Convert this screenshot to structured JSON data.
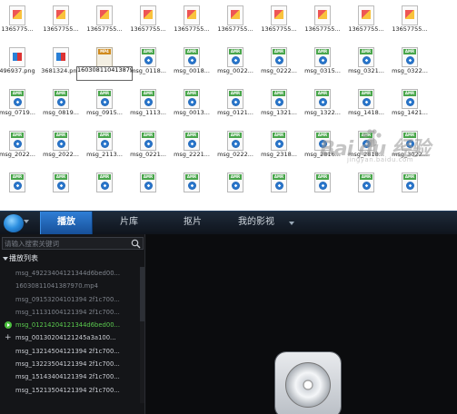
{
  "explorer": {
    "rows": [
      {
        "items": [
          {
            "label": "1365775...",
            "type": "doc"
          },
          {
            "label": "13657755...",
            "type": "doc"
          },
          {
            "label": "13657755...",
            "type": "doc"
          },
          {
            "label": "13657755...",
            "type": "doc"
          },
          {
            "label": "13657755...",
            "type": "doc"
          },
          {
            "label": "13657755...",
            "type": "doc"
          },
          {
            "label": "13657755...",
            "type": "doc"
          },
          {
            "label": "13657755...",
            "type": "doc"
          },
          {
            "label": "13657755...",
            "type": "doc"
          },
          {
            "label": "13657755...",
            "type": "doc"
          }
        ]
      },
      {
        "items": [
          {
            "label": "496937.png",
            "type": "png"
          },
          {
            "label": "3681324.png",
            "type": "png"
          },
          {
            "label": "16030811041387970.mp4",
            "type": "mp4",
            "selected": true,
            "tag": "MP4"
          },
          {
            "label": "msg_0118...",
            "type": "amr",
            "tag": "AMR"
          },
          {
            "label": "msg_0018...",
            "type": "amr",
            "tag": "AMR"
          },
          {
            "label": "msg_0022...",
            "type": "amr",
            "tag": "AMR"
          },
          {
            "label": "msg_0222...",
            "type": "amr",
            "tag": "AMR"
          },
          {
            "label": "msg_0315...",
            "type": "amr",
            "tag": "AMR"
          },
          {
            "label": "msg_0321...",
            "type": "amr",
            "tag": "AMR"
          },
          {
            "label": "msg_0322...",
            "type": "amr",
            "tag": "AMR"
          }
        ]
      },
      {
        "items": [
          {
            "label": "msg_0719...",
            "type": "amr",
            "tag": "AMR"
          },
          {
            "label": "msg_0819...",
            "type": "amr",
            "tag": "AMR"
          },
          {
            "label": "msg_0915...",
            "type": "amr",
            "tag": "AMR"
          },
          {
            "label": "msg_1113...",
            "type": "amr",
            "tag": "AMR"
          },
          {
            "label": "msg_0013...",
            "type": "amr",
            "tag": "AMR"
          },
          {
            "label": "msg_0121...",
            "type": "amr",
            "tag": "AMR"
          },
          {
            "label": "msg_1321...",
            "type": "amr",
            "tag": "AMR"
          },
          {
            "label": "msg_1322...",
            "type": "amr",
            "tag": "AMR"
          },
          {
            "label": "msg_1418...",
            "type": "amr",
            "tag": "AMR"
          },
          {
            "label": "msg_1421...",
            "type": "amr",
            "tag": "AMR"
          }
        ]
      },
      {
        "items": [
          {
            "label": "msg_2022...",
            "type": "amr",
            "tag": "AMR"
          },
          {
            "label": "msg_2022...",
            "type": "amr",
            "tag": "AMR"
          },
          {
            "label": "msg_2113...",
            "type": "amr",
            "tag": "AMR"
          },
          {
            "label": "msg_0221...",
            "type": "amr",
            "tag": "AMR"
          },
          {
            "label": "msg_2221...",
            "type": "amr",
            "tag": "AMR"
          },
          {
            "label": "msg_0222...",
            "type": "amr",
            "tag": "AMR"
          },
          {
            "label": "msg_2318...",
            "type": "amr",
            "tag": "AMR"
          },
          {
            "label": "msg_2816...",
            "type": "amr",
            "tag": "AMR"
          },
          {
            "label": "msg_2818...",
            "type": "amr",
            "tag": "AMR"
          },
          {
            "label": "msg_3022...",
            "type": "amr",
            "tag": "AMR"
          }
        ]
      },
      {
        "items": [
          {
            "label": "",
            "type": "amr",
            "tag": "AMR"
          },
          {
            "label": "",
            "type": "amr",
            "tag": "AMR"
          },
          {
            "label": "",
            "type": "amr",
            "tag": "AMR"
          },
          {
            "label": "",
            "type": "amr",
            "tag": "AMR"
          },
          {
            "label": "",
            "type": "amr",
            "tag": "AMR"
          },
          {
            "label": "",
            "type": "amr",
            "tag": "AMR"
          },
          {
            "label": "",
            "type": "amr",
            "tag": "AMR"
          },
          {
            "label": "",
            "type": "amr",
            "tag": "AMR"
          },
          {
            "label": "",
            "type": "amr",
            "tag": "AMR"
          },
          {
            "label": "",
            "type": "amr",
            "tag": "AMR"
          }
        ]
      }
    ],
    "watermark": {
      "text": "Bai du 经验",
      "sub": "jingyan.baidu.com"
    }
  },
  "player": {
    "tabs": {
      "play": "播放",
      "library": "片库",
      "clip": "抠片",
      "my_videos": "我的影视"
    },
    "search": {
      "placeholder": "请输入搜索关键词"
    },
    "playlist": {
      "title": "播放列表",
      "items": [
        {
          "label": "msg_49223404121344d6bed00...",
          "state": "dim"
        },
        {
          "label": "16030811041387970.mp4",
          "state": "dim"
        },
        {
          "label": "msg_09153204101394 2f1c700...",
          "state": "dim"
        },
        {
          "label": "msg_11131004121394 2f1c700...",
          "state": "dim"
        },
        {
          "label": "msg_01214204121344d6bed00...",
          "state": "active",
          "mark": "play"
        },
        {
          "label": "msg_00130204121245a3a100...",
          "state": "normal",
          "mark": "plus"
        },
        {
          "label": "msg_13214504121394 2f1c700...",
          "state": "normal"
        },
        {
          "label": "msg_13223504121394 2f1c700...",
          "state": "normal"
        },
        {
          "label": "msg_15143404121394 2f1c700...",
          "state": "normal"
        },
        {
          "label": "msg_15213504121394 2f1c700...",
          "state": "normal"
        }
      ]
    }
  }
}
